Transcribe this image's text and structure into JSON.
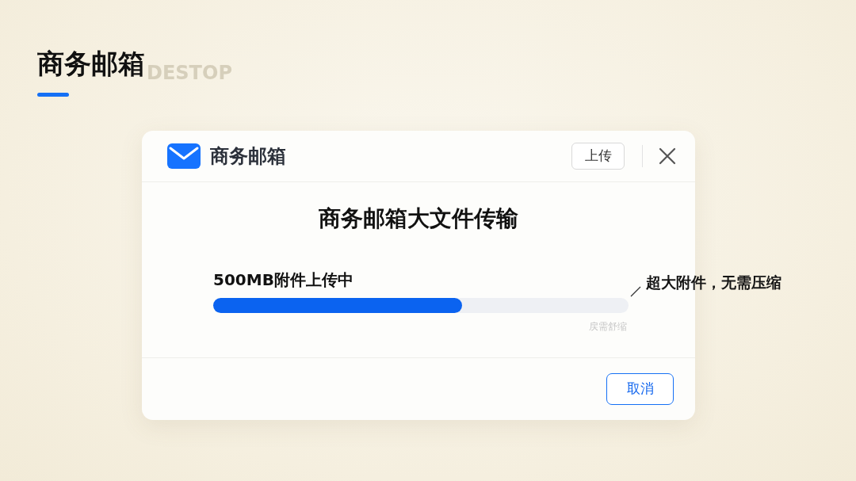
{
  "page": {
    "title": "商务邮箱",
    "background_text": "DESTOP"
  },
  "dialog": {
    "app_name": "商务邮箱",
    "upload_button": "上传",
    "heading": "商务邮箱大文件传输",
    "upload": {
      "label": "500MB附件上传中",
      "level": 0.6,
      "note": "戻需舒缩"
    },
    "callout": "超大附件，无需压缩",
    "buttons": [
      "取消"
    ]
  }
}
